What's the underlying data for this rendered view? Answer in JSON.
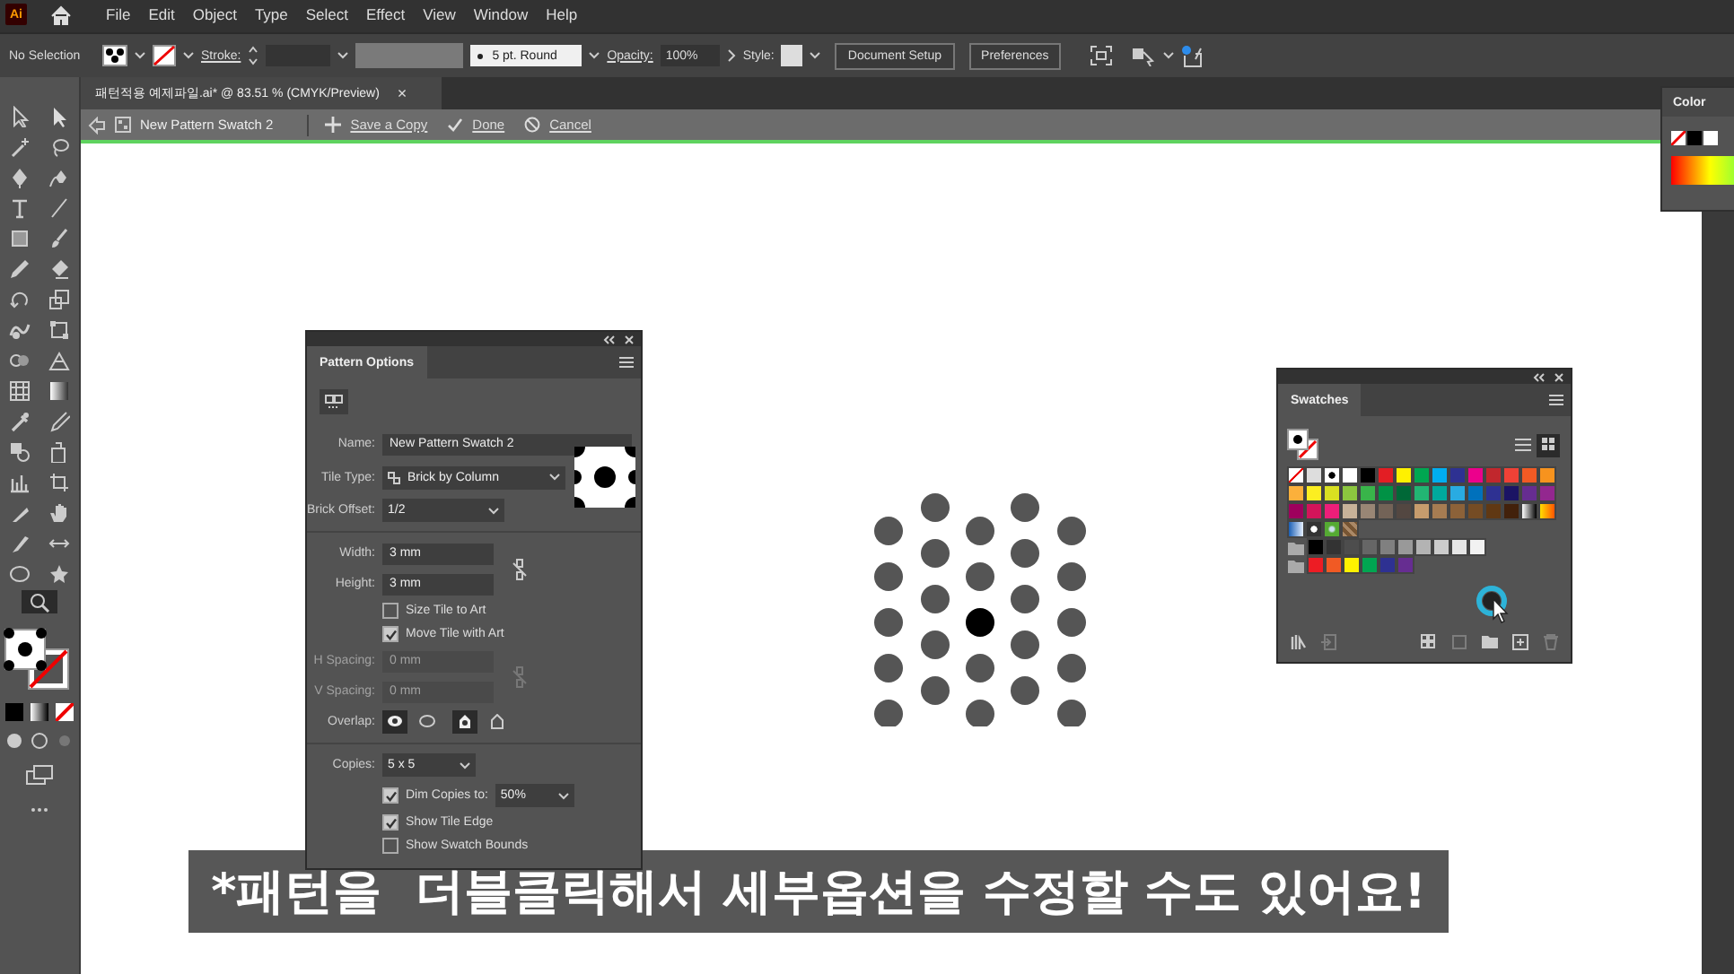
{
  "app": {
    "logo": "Ai",
    "menus": [
      "File",
      "Edit",
      "Object",
      "Type",
      "Select",
      "Effect",
      "View",
      "Window",
      "Help"
    ]
  },
  "control_bar": {
    "selection": "No Selection",
    "stroke_label": "Stroke:",
    "brush": "5 pt. Round",
    "opacity_label": "Opacity:",
    "opacity": "100%",
    "style_label": "Style:",
    "buttons": [
      "Document Setup",
      "Preferences"
    ]
  },
  "document_tab": {
    "title": "패턴적용 예제파일.ai* @ 83.51 % (CMYK/Preview)",
    "close": "×"
  },
  "pattern_bar": {
    "swatch_name": "New Pattern Swatch 2",
    "actions": [
      {
        "kind": "add",
        "label": "Save a Copy"
      },
      {
        "kind": "done",
        "label": "Done"
      },
      {
        "kind": "cancel",
        "label": "Cancel"
      }
    ]
  },
  "tools": [
    {
      "selected": false
    },
    {
      "selected": false
    },
    {
      "selected": false
    },
    {
      "selected": false
    },
    {
      "selected": false
    },
    {
      "selected": false
    },
    {
      "selected": false
    },
    {
      "selected": false
    },
    {
      "selected": false
    },
    {
      "selected": false
    },
    {
      "selected": false
    },
    {
      "selected": false
    },
    {
      "selected": false
    },
    {
      "selected": false
    },
    {
      "selected": false
    },
    {
      "selected": false
    },
    {
      "selected": false
    },
    {
      "selected": false
    },
    {
      "selected": false
    },
    {
      "selected": false
    },
    {
      "selected": false
    },
    {
      "selected": false
    },
    {
      "selected": false
    },
    {
      "selected": false
    },
    {
      "selected": false
    },
    {
      "selected": false
    },
    {
      "selected": false
    },
    {
      "selected": false
    },
    {
      "selected": false
    },
    {
      "selected": false
    },
    {
      "selected": false
    },
    {
      "selected": false
    },
    {
      "selected": true
    }
  ],
  "color_panel": {
    "title": "Color"
  },
  "pattern_options": {
    "title": "Pattern Options",
    "sections": [
      [
        {
          "kind": "plain",
          "rows": [
            {
              "kind": "text",
              "label": "Name:",
              "value": "New Pattern Swatch 2",
              "disabled": false
            },
            {
              "kind": "tile_select",
              "label": "Tile Type:",
              "value": "Brick by Column",
              "disabled": false
            },
            {
              "kind": "select",
              "label": "Brick Offset:",
              "value": "1/2",
              "disabled": false
            }
          ]
        }
      ],
      [
        {
          "kind": "pair",
          "rows": [
            {
              "kind": "text",
              "label": "Width:",
              "value": "3 mm",
              "disabled": false
            },
            {
              "kind": "text",
              "label": "Height:",
              "value": "3 mm",
              "disabled": false
            }
          ]
        },
        {
          "kind": "plain",
          "rows": [
            {
              "kind": "check",
              "label": "Size Tile to Art",
              "checked": false,
              "disabled": false
            },
            {
              "kind": "check",
              "label": "Move Tile with Art",
              "checked": true,
              "disabled": false
            }
          ]
        },
        {
          "kind": "pair",
          "rows": [
            {
              "kind": "text",
              "label": "H Spacing:",
              "value": "0 mm",
              "disabled": true
            },
            {
              "kind": "text",
              "label": "V Spacing:",
              "value": "0 mm",
              "disabled": true
            }
          ]
        },
        {
          "kind": "plain",
          "rows": [
            {
              "kind": "overlap",
              "label": "Overlap:",
              "disabled": false,
              "options": [
                {
                  "selected": true
                },
                {
                  "selected": false
                },
                {
                  "selected": true
                },
                {
                  "selected": false
                }
              ]
            }
          ]
        }
      ],
      [
        {
          "kind": "plain",
          "rows": [
            {
              "kind": "select",
              "label": "Copies:",
              "value": "5 x 5",
              "disabled": false
            },
            {
              "kind": "check_select",
              "label": "Dim Copies to:",
              "checked": true,
              "value": "50%",
              "disabled": false
            },
            {
              "kind": "check",
              "label": "Show Tile Edge",
              "checked": true,
              "disabled": false
            },
            {
              "kind": "check",
              "label": "Show Swatch Bounds",
              "checked": false,
              "disabled": false
            }
          ]
        }
      ]
    ]
  },
  "swatches": {
    "title": "Swatches",
    "views": [
      {
        "selected": false
      },
      {
        "selected": true
      }
    ],
    "rows": [
      [
        {
          "kind": "none"
        },
        {
          "kind": "registration"
        },
        {
          "kind": "pattern"
        },
        {
          "kind": "color",
          "color": "#ffffff"
        },
        {
          "kind": "color",
          "color": "#000000"
        },
        {
          "kind": "color",
          "color": "#e31e24"
        },
        {
          "kind": "color",
          "color": "#fff100"
        },
        {
          "kind": "color",
          "color": "#00a651"
        },
        {
          "kind": "color",
          "color": "#00aeef"
        },
        {
          "kind": "color",
          "color": "#2e3192"
        },
        {
          "kind": "color",
          "color": "#ec008c"
        },
        {
          "kind": "color",
          "color": "#c1272d"
        },
        {
          "kind": "color",
          "color": "#ef4136"
        },
        {
          "kind": "color",
          "color": "#f15a24"
        },
        {
          "kind": "color",
          "color": "#f7931e"
        }
      ],
      [
        {
          "kind": "color",
          "color": "#fbb03b"
        },
        {
          "kind": "color",
          "color": "#fcee21"
        },
        {
          "kind": "color",
          "color": "#d9e021"
        },
        {
          "kind": "color",
          "color": "#8cc63f"
        },
        {
          "kind": "color",
          "color": "#39b54a"
        },
        {
          "kind": "color",
          "color": "#009245"
        },
        {
          "kind": "color",
          "color": "#006837"
        },
        {
          "kind": "color",
          "color": "#22b573"
        },
        {
          "kind": "color",
          "color": "#00a99d"
        },
        {
          "kind": "color",
          "color": "#29abe2"
        },
        {
          "kind": "color",
          "color": "#0071bc"
        },
        {
          "kind": "color",
          "color": "#2e3192"
        },
        {
          "kind": "color",
          "color": "#1b1464"
        },
        {
          "kind": "color",
          "color": "#662d91"
        },
        {
          "kind": "color",
          "color": "#93278f"
        }
      ],
      [
        {
          "kind": "color",
          "color": "#9e005d"
        },
        {
          "kind": "color",
          "color": "#d4145a"
        },
        {
          "kind": "color",
          "color": "#ed1e79"
        },
        {
          "kind": "color",
          "color": "#c7b299"
        },
        {
          "kind": "color",
          "color": "#998675"
        },
        {
          "kind": "color",
          "color": "#736357"
        },
        {
          "kind": "color",
          "color": "#534741"
        },
        {
          "kind": "color",
          "color": "#c69c6d"
        },
        {
          "kind": "color",
          "color": "#a67c52"
        },
        {
          "kind": "color",
          "color": "#8c6239"
        },
        {
          "kind": "color",
          "color": "#754c24"
        },
        {
          "kind": "color",
          "color": "#603813"
        },
        {
          "kind": "color",
          "color": "#42210b"
        },
        {
          "kind": "gradient_grey"
        },
        {
          "kind": "gradient_orange"
        }
      ],
      [
        {
          "kind": "gradient_blue"
        },
        {
          "kind": "pattern_dots"
        },
        {
          "kind": "pattern_green"
        },
        {
          "kind": "pattern_brown"
        }
      ],
      [
        {
          "kind": "folder"
        },
        {
          "kind": "color",
          "color": "#000000"
        },
        {
          "kind": "color",
          "color": "#333333"
        },
        {
          "kind": "color",
          "color": "#4d4d4d"
        },
        {
          "kind": "color",
          "color": "#666666"
        },
        {
          "kind": "color",
          "color": "#808080"
        },
        {
          "kind": "color",
          "color": "#999999"
        },
        {
          "kind": "color",
          "color": "#b3b3b3"
        },
        {
          "kind": "color",
          "color": "#cccccc"
        },
        {
          "kind": "color",
          "color": "#e6e6e6"
        },
        {
          "kind": "color",
          "color": "#f2f2f2"
        }
      ],
      [
        {
          "kind": "folder"
        },
        {
          "kind": "color",
          "color": "#ed1c24"
        },
        {
          "kind": "color",
          "color": "#f15a24"
        },
        {
          "kind": "color",
          "color": "#fff200"
        },
        {
          "kind": "color",
          "color": "#00a651"
        },
        {
          "kind": "color",
          "color": "#2e3192"
        },
        {
          "kind": "color",
          "color": "#662d91"
        }
      ]
    ],
    "bottom_tools": [
      {
        "disabled": false
      },
      {
        "disabled": true
      },
      {
        "disabled": false
      },
      {
        "disabled": true
      },
      {
        "disabled": false
      },
      {
        "disabled": false
      },
      {
        "disabled": true
      }
    ]
  },
  "caption": "*패턴을  더블클릭해서 세부옵션을 수정할 수도 있어요!"
}
